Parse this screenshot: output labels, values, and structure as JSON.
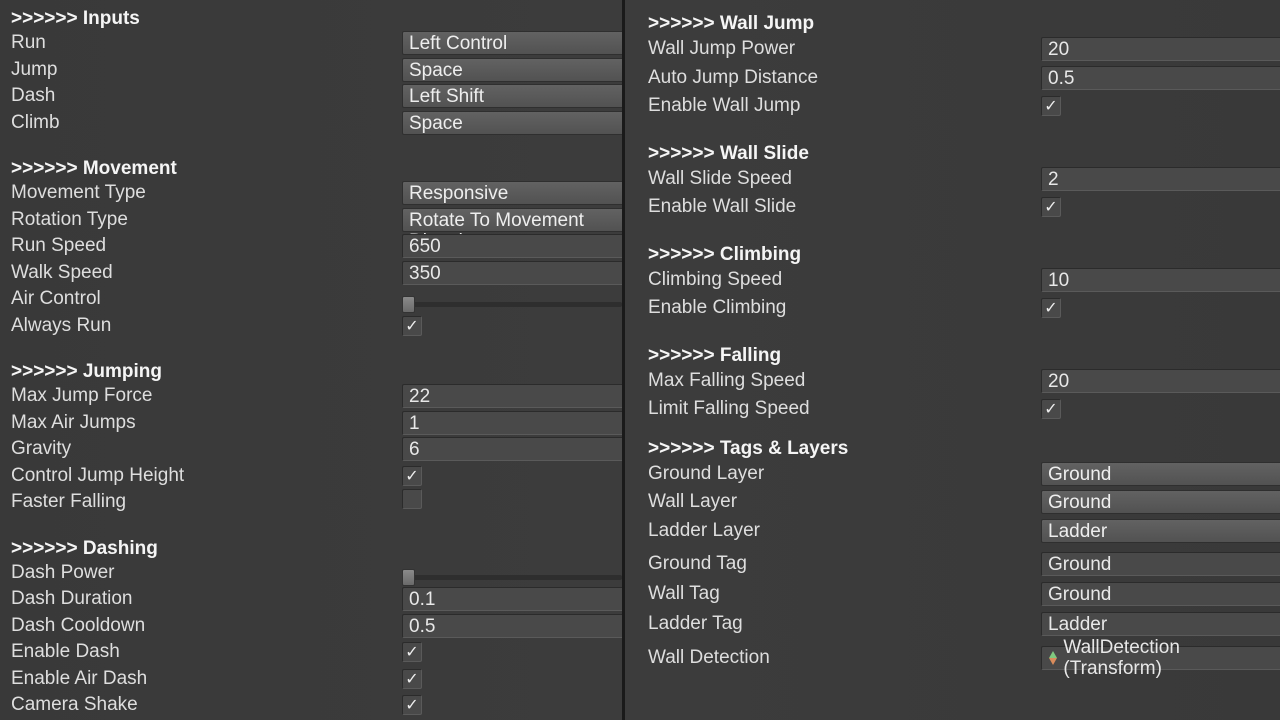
{
  "inputs": {
    "header": ">>>>>> Inputs",
    "run": {
      "label": "Run",
      "value": "Left Control"
    },
    "jump": {
      "label": "Jump",
      "value": "Space"
    },
    "dash": {
      "label": "Dash",
      "value": "Left Shift"
    },
    "climb": {
      "label": "Climb",
      "value": "Space"
    }
  },
  "movement": {
    "header": ">>>>>> Movement",
    "movement_type": {
      "label": "Movement Type",
      "value": "Responsive"
    },
    "rotation_type": {
      "label": "Rotation Type",
      "value": "Rotate To Movement Direction"
    },
    "run_speed": {
      "label": "Run Speed",
      "value": "650"
    },
    "walk_speed": {
      "label": "Walk Speed",
      "value": "350"
    },
    "air_control": {
      "label": "Air Control",
      "slider": 0.02
    },
    "always_run": {
      "label": "Always Run",
      "checked": true
    }
  },
  "jumping": {
    "header": ">>>>>> Jumping",
    "max_jump_force": {
      "label": "Max Jump Force",
      "value": "22"
    },
    "max_air_jumps": {
      "label": "Max Air Jumps",
      "value": "1"
    },
    "gravity": {
      "label": "Gravity",
      "value": "6"
    },
    "control_jump_height": {
      "label": "Control Jump Height",
      "checked": true
    },
    "faster_falling": {
      "label": "Faster Falling",
      "checked": false
    }
  },
  "dashing": {
    "header": ">>>>>> Dashing",
    "dash_power": {
      "label": "Dash Power",
      "slider": 0.02
    },
    "dash_duration": {
      "label": "Dash Duration",
      "value": "0.1"
    },
    "dash_cooldown": {
      "label": "Dash Cooldown",
      "value": "0.5"
    },
    "enable_dash": {
      "label": "Enable Dash",
      "checked": true
    },
    "enable_air_dash": {
      "label": "Enable Air Dash",
      "checked": true
    },
    "camera_shake": {
      "label": "Camera Shake",
      "checked": true
    }
  },
  "wall_jump": {
    "header": ">>>>>> Wall Jump",
    "wall_jump_power": {
      "label": "Wall Jump Power",
      "value": "20"
    },
    "auto_jump_distance": {
      "label": "Auto Jump Distance",
      "value": "0.5"
    },
    "enable_wall_jump": {
      "label": "Enable Wall Jump",
      "checked": true
    }
  },
  "wall_slide": {
    "header": ">>>>>> Wall Slide",
    "wall_slide_speed": {
      "label": "Wall Slide Speed",
      "value": "2"
    },
    "enable_wall_slide": {
      "label": "Enable Wall Slide",
      "checked": true
    }
  },
  "climbing": {
    "header": ">>>>>> Climbing",
    "climbing_speed": {
      "label": "Climbing Speed",
      "value": "10"
    },
    "enable_climbing": {
      "label": "Enable Climbing",
      "checked": true
    }
  },
  "falling": {
    "header": ">>>>>> Falling",
    "max_falling_speed": {
      "label": "Max Falling Speed",
      "value": "20"
    },
    "limit_falling_speed": {
      "label": "Limit Falling Speed",
      "checked": true
    }
  },
  "tags_layers": {
    "header": ">>>>>> Tags & Layers",
    "ground_layer": {
      "label": "Ground Layer",
      "value": "Ground"
    },
    "wall_layer": {
      "label": "Wall Layer",
      "value": "Ground"
    },
    "ladder_layer": {
      "label": "Ladder Layer",
      "value": "Ladder"
    },
    "ground_tag": {
      "label": "Ground Tag",
      "value": "Ground"
    },
    "wall_tag": {
      "label": "Wall Tag",
      "value": "Ground"
    },
    "ladder_tag": {
      "label": "Ladder Tag",
      "value": "Ladder"
    },
    "wall_detection": {
      "label": "Wall Detection",
      "value": "WallDetection (Transform)"
    }
  }
}
